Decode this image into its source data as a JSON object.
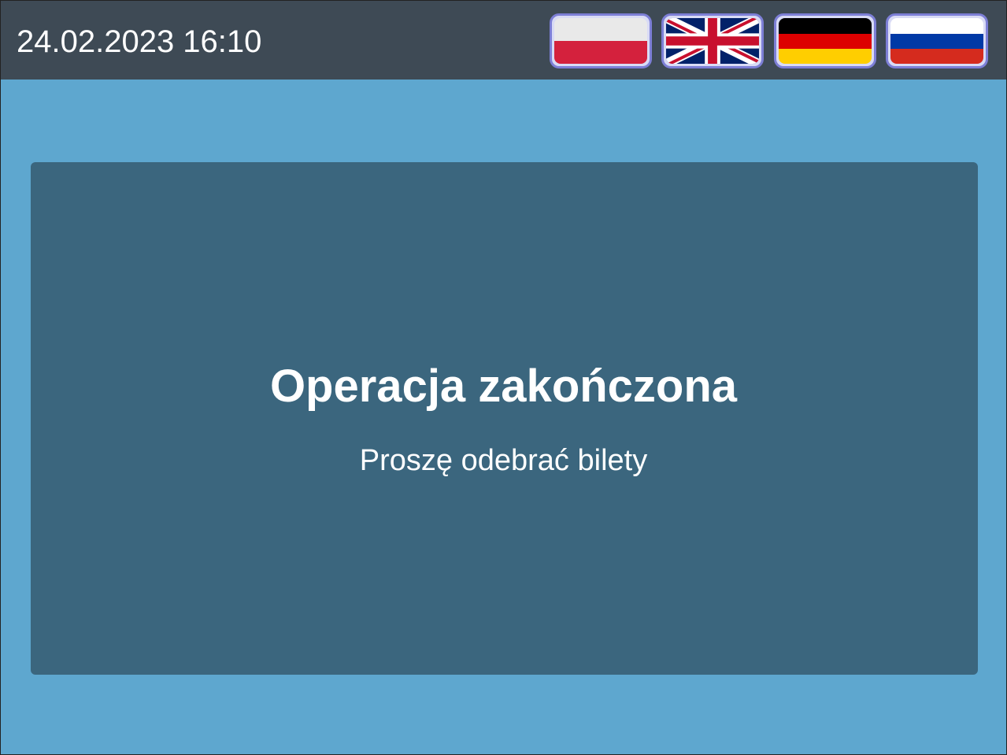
{
  "header": {
    "datetime": "24.02.2023 16:10"
  },
  "languages": [
    {
      "code": "pl",
      "icon": "poland-flag-icon",
      "colors": [
        "#e9e9e9",
        "#d4213d"
      ]
    },
    {
      "code": "en",
      "icon": "uk-flag-icon",
      "colors": [
        "#012169",
        "#ffffff",
        "#c8102e"
      ]
    },
    {
      "code": "de",
      "icon": "germany-flag-icon",
      "colors": [
        "#000000",
        "#dd0000",
        "#ffce00"
      ]
    },
    {
      "code": "ru",
      "icon": "russia-flag-icon",
      "colors": [
        "#ffffff",
        "#0039a6",
        "#d52b1e"
      ]
    }
  ],
  "message": {
    "title": "Operacja zakończona",
    "subtitle": "Proszę odebrać bilety"
  },
  "colors": {
    "background": "#5ea7cf",
    "topbar": "#3e4a55",
    "panel": "#3b667e",
    "flag_border": "#7d7fd6",
    "text": "#ffffff"
  }
}
